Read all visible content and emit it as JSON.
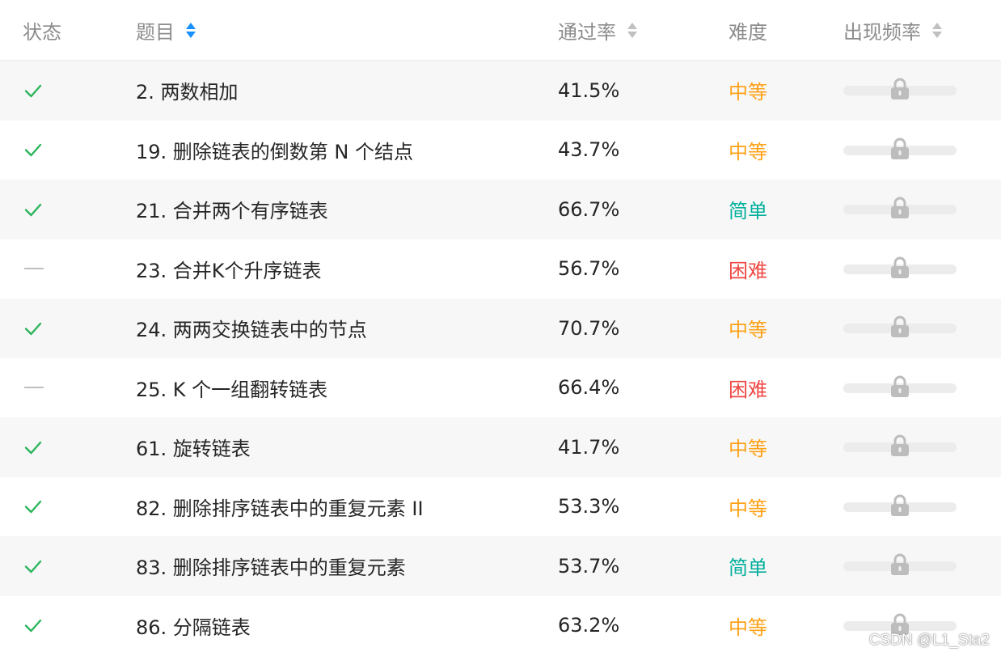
{
  "header": {
    "status": "状态",
    "title": "题目",
    "rate": "通过率",
    "difficulty": "难度",
    "frequency": "出现频率"
  },
  "colors": {
    "medium": "#ffa116",
    "easy": "#00af9b",
    "hard": "#ef4743",
    "check": "#2db55d",
    "sort_active": "#1890ff"
  },
  "rows": [
    {
      "status": "solved",
      "title": "2. 两数相加",
      "rate": "41.5%",
      "difficulty": "中等",
      "level": "medium",
      "frequency_icon": "lock-icon"
    },
    {
      "status": "solved",
      "title": "19. 删除链表的倒数第 N 个结点",
      "rate": "43.7%",
      "difficulty": "中等",
      "level": "medium",
      "frequency_icon": "lock-icon"
    },
    {
      "status": "solved",
      "title": "21. 合并两个有序链表",
      "rate": "66.7%",
      "difficulty": "简单",
      "level": "easy",
      "frequency_icon": "lock-icon"
    },
    {
      "status": "attempted",
      "title": "23. 合并K个升序链表",
      "rate": "56.7%",
      "difficulty": "困难",
      "level": "hard",
      "frequency_icon": "lock-icon"
    },
    {
      "status": "solved",
      "title": "24. 两两交换链表中的节点",
      "rate": "70.7%",
      "difficulty": "中等",
      "level": "medium",
      "frequency_icon": "lock-icon"
    },
    {
      "status": "attempted",
      "title": "25. K 个一组翻转链表",
      "rate": "66.4%",
      "difficulty": "困难",
      "level": "hard",
      "frequency_icon": "lock-icon"
    },
    {
      "status": "solved",
      "title": "61. 旋转链表",
      "rate": "41.7%",
      "difficulty": "中等",
      "level": "medium",
      "frequency_icon": "lock-icon"
    },
    {
      "status": "solved",
      "title": "82. 删除排序链表中的重复元素 II",
      "rate": "53.3%",
      "difficulty": "中等",
      "level": "medium",
      "frequency_icon": "lock-icon"
    },
    {
      "status": "solved",
      "title": "83. 删除排序链表中的重复元素",
      "rate": "53.7%",
      "difficulty": "简单",
      "level": "easy",
      "frequency_icon": "lock-icon"
    },
    {
      "status": "solved",
      "title": "86. 分隔链表",
      "rate": "63.2%",
      "difficulty": "中等",
      "level": "medium",
      "frequency_icon": "lock-icon"
    }
  ],
  "watermark": "CSDN @L1_Sta2"
}
